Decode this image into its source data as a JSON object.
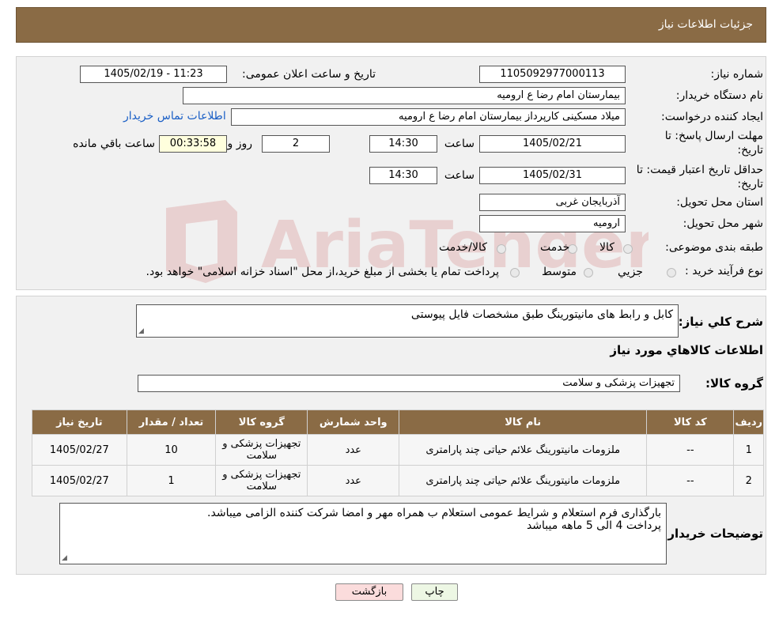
{
  "header": {
    "title": "جزئیات اطلاعات نیاز"
  },
  "form": {
    "need_number_label": "شماره نیاز:",
    "need_number": "1105092977000113",
    "announce_label": "تاریخ و ساعت اعلان عمومی:",
    "announce_value": "1405/02/19 - 11:23",
    "buyer_org_label": "نام دستگاه خریدار:",
    "buyer_org": "بیمارستان امام رضا  ع  ارومیه",
    "creator_label": "ایجاد کننده درخواست:",
    "creator": "میلاد مسکینی کارپرداز بیمارستان امام رضا  ع  ارومیه",
    "contact_link": "اطلاعات تماس خریدار",
    "deadline_label": "مهلت ارسال پاسخ: تا تاریخ:",
    "deadline_date": "1405/02/21",
    "time_label": "ساعت",
    "deadline_time": "14:30",
    "days_value": "2",
    "days_label": "روز و",
    "remaining_value": "00:33:58",
    "remaining_label": "ساعت باقي مانده",
    "validity_label": "حداقل تاریخ اعتبار قیمت: تا تاریخ:",
    "validity_date": "1405/02/31",
    "validity_time": "14:30",
    "province_label": "استان محل تحویل:",
    "province": "آذربایجان غربی",
    "city_label": "شهر محل تحویل:",
    "city": "ارومیه",
    "category_label": "طبقه بندی موضوعی:",
    "category_options": [
      "کالا",
      "خدمت",
      "کالا/خدمت"
    ],
    "purchase_type_label": "نوع فرآیند خرید :",
    "purchase_options": [
      "جزیي",
      "متوسط"
    ],
    "purchase_note": "پرداخت تمام یا بخشی از مبلغ خرید،از محل \"اسناد خزانه اسلامی\" خواهد بود."
  },
  "summary": {
    "description_label": "شرح کلي نیاز:",
    "description": "کابل  و رابط های مانیتورینگ طبق مشخصات فایل پیوستی",
    "goods_info_title": "اطلاعات کالاهاي مورد نیاز",
    "goods_group_label": "گروه کالا:",
    "goods_group": "تجهیزات پزشکی و سلامت"
  },
  "table": {
    "headers": [
      "ردیف",
      "کد کالا",
      "نام کالا",
      "واحد شمارش",
      "گروه کالا",
      "تعداد / مقدار",
      "تاریخ نیاز"
    ],
    "rows": [
      [
        "1",
        "--",
        "ملزومات مانیتورینگ علائم حیاتی چند پارامتری",
        "عدد",
        "تجهیزات پزشکی و سلامت",
        "10",
        "1405/02/27"
      ],
      [
        "2",
        "--",
        "ملزومات مانیتورینگ علائم حیاتی چند پارامتری",
        "عدد",
        "تجهیزات پزشکی و سلامت",
        "1",
        "1405/02/27"
      ]
    ]
  },
  "notes": {
    "label": "توضیحات خریدار:",
    "line1": "بارگذاری فرم استعلام و شرایط عمومی استعلام ب همراه مهر و امضا شرکت کننده الزامی میباشد.",
    "line2": "پرداخت 4 الی 5 ماهه میباشد"
  },
  "buttons": {
    "print": "چاپ",
    "back": "بازگشت"
  },
  "watermark": {
    "text": "AriaTender.neT"
  },
  "colors": {
    "header_bg": "#8a6b45",
    "link": "#1a5fc6",
    "back_btn": "#fbdcdc",
    "print_btn": "#edf7e4"
  }
}
